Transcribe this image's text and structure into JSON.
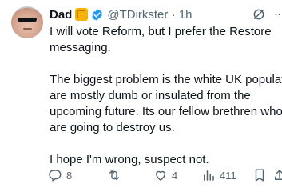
{
  "tweet": {
    "display_name": "Dad",
    "handle": "@TDirkster",
    "separator": "·",
    "time": "1h",
    "body": [
      "I will vote Reform, but I prefer the Restore",
      "messaging.",
      "The biggest problem is the white UK population",
      "are mostly dumb or insulated from the",
      "upcoming future. Its our fellow brethren who",
      "are going to destroy us.",
      "I hope I'm wrong, suspect not."
    ],
    "actions": {
      "replies": "8",
      "retweets": "",
      "likes": "4",
      "views": "411"
    }
  },
  "icons": {
    "avatar": "profile-photo",
    "name_emoji": "emoji-icon",
    "verified": "verified-badge-icon",
    "grok": "grok-icon",
    "more": "more-icon",
    "reply": "reply-icon",
    "retweet": "retweet-icon",
    "like": "like-icon",
    "views": "views-icon",
    "bookmark": "bookmark-icon",
    "share": "share-icon"
  },
  "colors": {
    "text": "#0f1419",
    "secondary": "#536471",
    "verified": "#1d9bf0",
    "emoji": "#f4b400"
  }
}
